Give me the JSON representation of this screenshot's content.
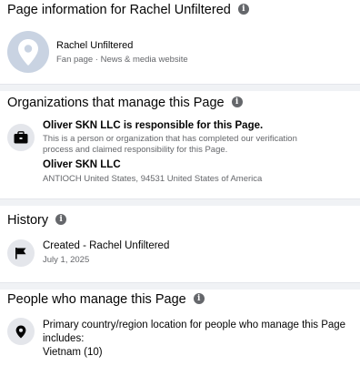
{
  "page_info": {
    "title": "Page information for Rachel Unfiltered",
    "page_name": "Rachel Unfiltered",
    "page_category": "Fan page · News & media website"
  },
  "organizations": {
    "title": "Organizations that manage this Page",
    "responsible_heading": "Oliver SKN LLC is responsible for this Page.",
    "responsible_description_line1": "This is a person or organization that has completed our verification",
    "responsible_description_line2": "process and claimed responsibility for this Page.",
    "org_name": "Oliver SKN LLC",
    "org_address": "ANTIOCH United States, 94531 United States of America"
  },
  "history": {
    "title": "History",
    "event_label": "Created - Rachel Unfiltered",
    "event_date": "July 1, 2025"
  },
  "people": {
    "title": "People who manage this Page",
    "location_line1": "Primary country/region location for people who manage this Page",
    "location_line2": "includes:",
    "location_value": "Vietnam (10)"
  },
  "icons": {
    "info": "info-icon",
    "location_pin": "location-pin-icon",
    "briefcase": "briefcase-icon",
    "flag": "flag-icon",
    "map_marker": "map-marker-icon"
  },
  "colors": {
    "divider": "#f0f2f5",
    "secondary_text": "#65676b",
    "icon_bg": "#e4e6eb",
    "avatar_bg": "#c9d3e2"
  }
}
